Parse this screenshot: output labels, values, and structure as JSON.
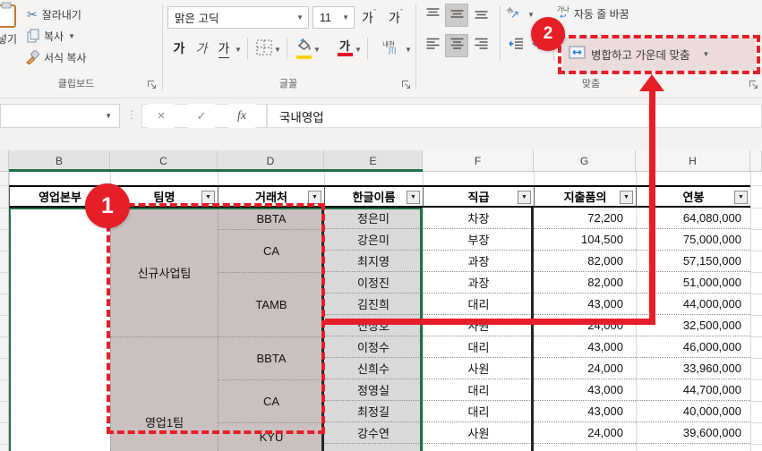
{
  "ribbon": {
    "clipboard": {
      "label": "클립보드",
      "paste_label": "넣기",
      "cut_label": "잘라내기",
      "copy_label": "복사",
      "format_painter_label": "서식 복사"
    },
    "font": {
      "label": "글꼴",
      "font_name": "맑은 고딕",
      "font_size": "11",
      "grow_glyph": "가",
      "shrink_glyph": "가",
      "bold_glyph": "가",
      "italic_glyph": "가",
      "underline_glyph": "가",
      "font_color_glyph": "가",
      "phonetic_top": "내천",
      "phonetic_bottom": "川"
    },
    "alignment": {
      "label": "맞춤",
      "orientation_glyph": "개",
      "wrap_icon_text": "가나",
      "wrap_text_label": "자동 줄 바꿈",
      "merge_center_label": "병합하고 가운데 맞춤"
    }
  },
  "formula_bar": {
    "name_box_value": "",
    "cancel_glyph": "×",
    "enter_glyph": "✓",
    "fx_glyph": "fx",
    "value": "국내영업"
  },
  "sheet": {
    "column_letters": [
      "B",
      "C",
      "D",
      "E",
      "F",
      "G",
      "H"
    ],
    "selected_columns": [
      "B",
      "C",
      "D",
      "E"
    ],
    "table": {
      "headers": [
        "영업본부",
        "팀명",
        "거래처",
        "한글이름",
        "직급",
        "지출품의",
        "연봉"
      ],
      "division_cell_text": "",
      "team_merges": [
        {
          "label": "신규사업팀",
          "from": 1,
          "to": 6
        },
        {
          "label": "영업1팀",
          "from": 7,
          "to": 12,
          "label_y": 470
        }
      ],
      "client_merges": [
        {
          "label": "BBTA",
          "from": 1,
          "to": 1
        },
        {
          "label": "CA",
          "from": 2,
          "to": 3
        },
        {
          "label": "TAMB",
          "from": 4,
          "to": 6
        },
        {
          "label": "BBTA",
          "from": 7,
          "to": 8
        },
        {
          "label": "CA",
          "from": 9,
          "to": 10
        },
        {
          "label": "KYU",
          "from": 11,
          "to": 12
        }
      ],
      "rows": [
        {
          "name": "정은미",
          "rank": "차장",
          "expense": "72,200",
          "salary": "64,080,000"
        },
        {
          "name": "강은미",
          "rank": "부장",
          "expense": "104,500",
          "salary": "75,000,000"
        },
        {
          "name": "최지영",
          "rank": "과장",
          "expense": "82,000",
          "salary": "57,150,000"
        },
        {
          "name": "이정진",
          "rank": "과장",
          "expense": "82,000",
          "salary": "51,000,000"
        },
        {
          "name": "김진희",
          "rank": "대리",
          "expense": "43,000",
          "salary": "44,000,000"
        },
        {
          "name": "신상호",
          "rank": "사원",
          "expense": "24,000",
          "salary": "32,500,000"
        },
        {
          "name": "이정수",
          "rank": "대리",
          "expense": "43,000",
          "salary": "46,000,000"
        },
        {
          "name": "신희수",
          "rank": "사원",
          "expense": "24,000",
          "salary": "33,960,000"
        },
        {
          "name": "정영실",
          "rank": "대리",
          "expense": "43,000",
          "salary": "44,700,000"
        },
        {
          "name": "최정길",
          "rank": "대리",
          "expense": "43,000",
          "salary": "40,000,000"
        },
        {
          "name": "강수연",
          "rank": "사원",
          "expense": "24,000",
          "salary": "39,600,000"
        },
        {
          "name": "",
          "rank": "",
          "expense": "",
          "salary": ""
        }
      ]
    }
  },
  "callouts": {
    "step1": "1",
    "step2": "2"
  },
  "colors": {
    "callout_red": "#e61e28",
    "selection_green": "#1e7145",
    "merged_fill": "#cbc0c0",
    "name_fill": "#d9d9d9",
    "merge_button_highlight": "#ecdbdb",
    "fill_color_swatch": "#ffd400",
    "font_color_swatch": "#e81123"
  }
}
